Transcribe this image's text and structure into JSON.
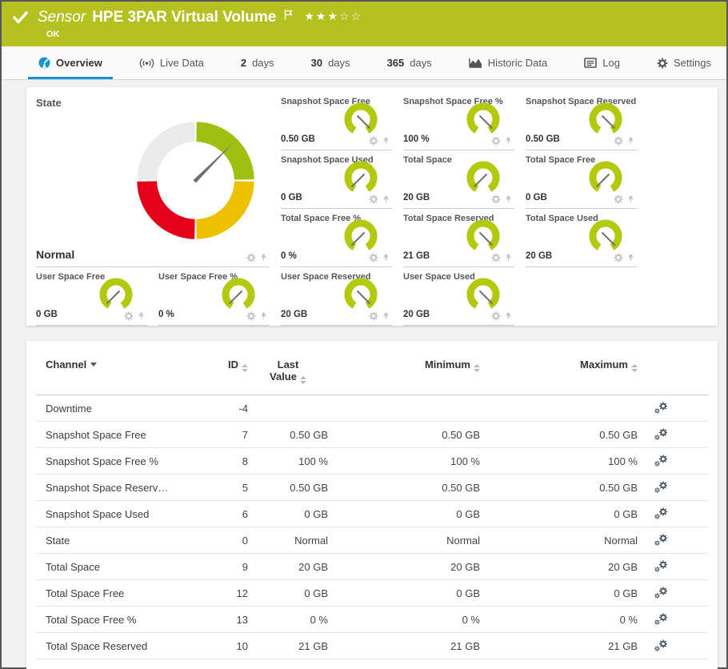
{
  "colors": {
    "brand_green": "#b5c120",
    "accent_blue": "#1792d2",
    "gauge_green": "#b2c90e",
    "state_green": "#a0c011",
    "state_yellow": "#eec100",
    "state_red": "#e2001a",
    "state_gray": "#ebebeb",
    "needle_gray": "#6e6e6e",
    "icon_gray": "#c3c3c3",
    "settings_icon": "#3d4f5d"
  },
  "header": {
    "kicker": "Sensor",
    "title": "HPE 3PAR Virtual Volume",
    "rating": "★★★☆☆",
    "rating_value": 3,
    "rating_max": 5,
    "status": "OK"
  },
  "tabs": [
    {
      "label": "Overview",
      "active": true
    },
    {
      "label": "Live Data"
    },
    {
      "strong": "2",
      "label": "days"
    },
    {
      "strong": "30",
      "label": "days"
    },
    {
      "strong": "365",
      "label": "days"
    },
    {
      "label": "Historic Data"
    },
    {
      "label": "Log"
    },
    {
      "label": "Settings"
    }
  ],
  "state_gauge": {
    "title": "State",
    "value": "Normal",
    "needle_angle": 45,
    "segment_order": [
      "state_gray",
      "state_green",
      "state_yellow",
      "state_red"
    ]
  },
  "gauge_tiles": [
    {
      "title": "Snapshot Space Free",
      "value": "0.50 GB",
      "needle_angle": 135
    },
    {
      "title": "Snapshot Space Free %",
      "value": "100 %",
      "needle_angle": 135
    },
    {
      "title": "Snapshot Space Reserved",
      "value": "0.50 GB",
      "needle_angle": 135
    },
    {
      "title": "Snapshot Space Used",
      "value": "0 GB",
      "needle_angle": 225
    },
    {
      "title": "Total Space",
      "value": "20 GB",
      "needle_angle": 225
    },
    {
      "title": "Total Space Free",
      "value": "0 GB",
      "needle_angle": 225
    },
    {
      "title": "Total Space Free %",
      "value": "0 %",
      "needle_angle": 225
    },
    {
      "title": "Total Space Reserved",
      "value": "21 GB",
      "needle_angle": 135
    },
    {
      "title": "Total Space Used",
      "value": "20 GB",
      "needle_angle": 135
    },
    {
      "title": "User Space Free",
      "value": "0 GB",
      "needle_angle": 225
    },
    {
      "title": "User Space Free %",
      "value": "0 %",
      "needle_angle": 225
    },
    {
      "title": "User Space Reserved",
      "value": "20 GB",
      "needle_angle": 135
    },
    {
      "title": "User Space Used",
      "value": "20 GB",
      "needle_angle": 135
    }
  ],
  "table": {
    "columns": {
      "channel": "Channel",
      "id": "ID",
      "last_value": "Last Value",
      "minimum": "Minimum",
      "maximum": "Maximum"
    },
    "sorted_by": "Channel",
    "rows": [
      {
        "channel": "Downtime",
        "id": "-4",
        "last": "",
        "min": "",
        "max": ""
      },
      {
        "channel": "Snapshot Space Free",
        "id": "7",
        "last": "0.50 GB",
        "min": "0.50 GB",
        "max": "0.50 GB"
      },
      {
        "channel": "Snapshot Space Free %",
        "id": "8",
        "last": "100 %",
        "min": "100 %",
        "max": "100 %"
      },
      {
        "channel": "Snapshot Space Reserv…",
        "id": "5",
        "last": "0.50 GB",
        "min": "0.50 GB",
        "max": "0.50 GB"
      },
      {
        "channel": "Snapshot Space Used",
        "id": "6",
        "last": "0 GB",
        "min": "0 GB",
        "max": "0 GB"
      },
      {
        "channel": "State",
        "id": "0",
        "last": "Normal",
        "min": "Normal",
        "max": "Normal"
      },
      {
        "channel": "Total Space",
        "id": "9",
        "last": "20 GB",
        "min": "20 GB",
        "max": "20 GB"
      },
      {
        "channel": "Total Space Free",
        "id": "12",
        "last": "0 GB",
        "min": "0 GB",
        "max": "0 GB"
      },
      {
        "channel": "Total Space Free %",
        "id": "13",
        "last": "0 %",
        "min": "0 %",
        "max": "0 %"
      },
      {
        "channel": "Total Space Reserved",
        "id": "10",
        "last": "21 GB",
        "min": "21 GB",
        "max": "21 GB"
      }
    ]
  }
}
